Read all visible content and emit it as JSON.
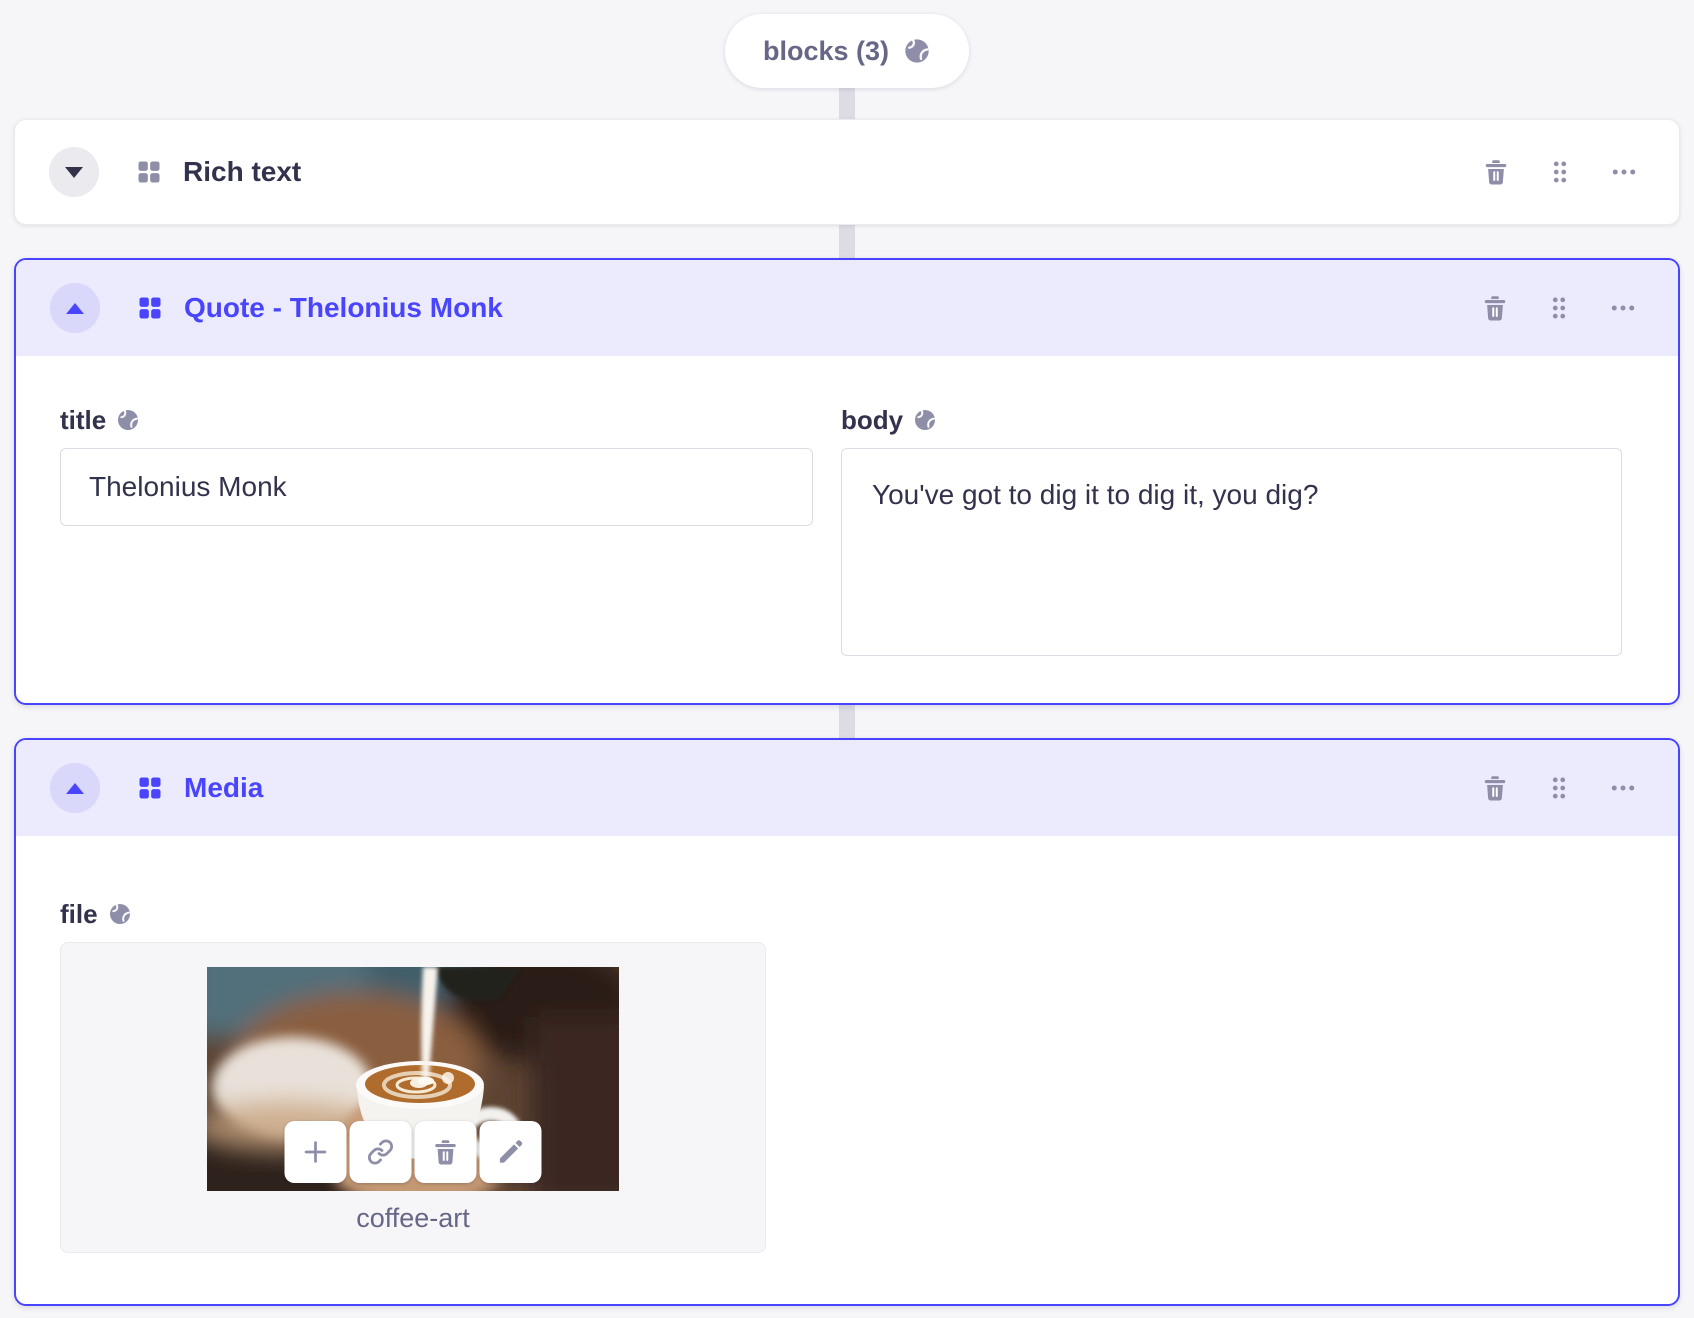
{
  "colors": {
    "accent": "#4945ff",
    "accent_header_bg": "#eceafd",
    "icon_gray": "#8e8ea9",
    "heading_text": "#32324d",
    "muted_text": "#666687",
    "page_bg": "#f6f6f9",
    "input_border": "#dcdce4"
  },
  "pill": {
    "label": "blocks (3)"
  },
  "icons": {
    "localized": "globe-icon",
    "component": "grid-icon",
    "collapsed_toggle": "chevron-down-icon",
    "expanded_toggle": "chevron-up-icon",
    "delete": "trash-icon",
    "drag": "drag-handle-dots-icon",
    "more": "ellipsis-icon",
    "media_add": "plus-icon",
    "media_link": "link-icon",
    "media_delete": "trash-icon",
    "media_edit": "pencil-icon"
  },
  "blocks": [
    {
      "title": "Rich text",
      "state": "collapsed"
    },
    {
      "title": "Quote - Thelonius Monk",
      "state": "expanded",
      "title_field": {
        "label": "title",
        "value": "Thelonius Monk"
      },
      "body_field": {
        "label": "body",
        "value": "You've got to dig it to dig it, you dig?"
      }
    },
    {
      "title": "Media",
      "state": "expanded",
      "file_field": {
        "label": "file",
        "file_name": "coffee-art"
      }
    }
  ]
}
